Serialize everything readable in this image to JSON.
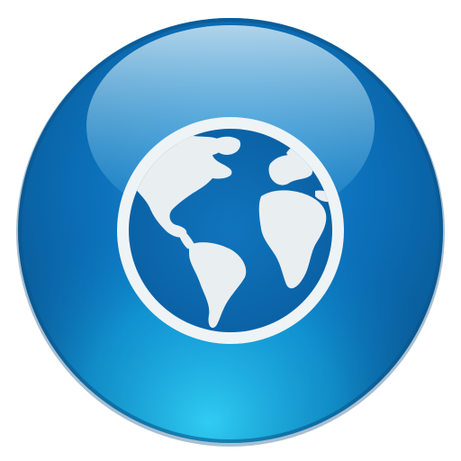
{
  "icon": {
    "name": "globe-icon",
    "colors": {
      "background": "#ffffff",
      "rim_dark": "#0a5f9e",
      "orb_top": "#1e8fd6",
      "orb_mid": "#0b74be",
      "orb_bottom": "#0fa9e3",
      "glow": "#27c2f0",
      "highlight": "#bfe9fb",
      "globe_fill": "#0e6fb8",
      "globe_ring": "#eef3f6",
      "land": "#e9eef1"
    }
  }
}
